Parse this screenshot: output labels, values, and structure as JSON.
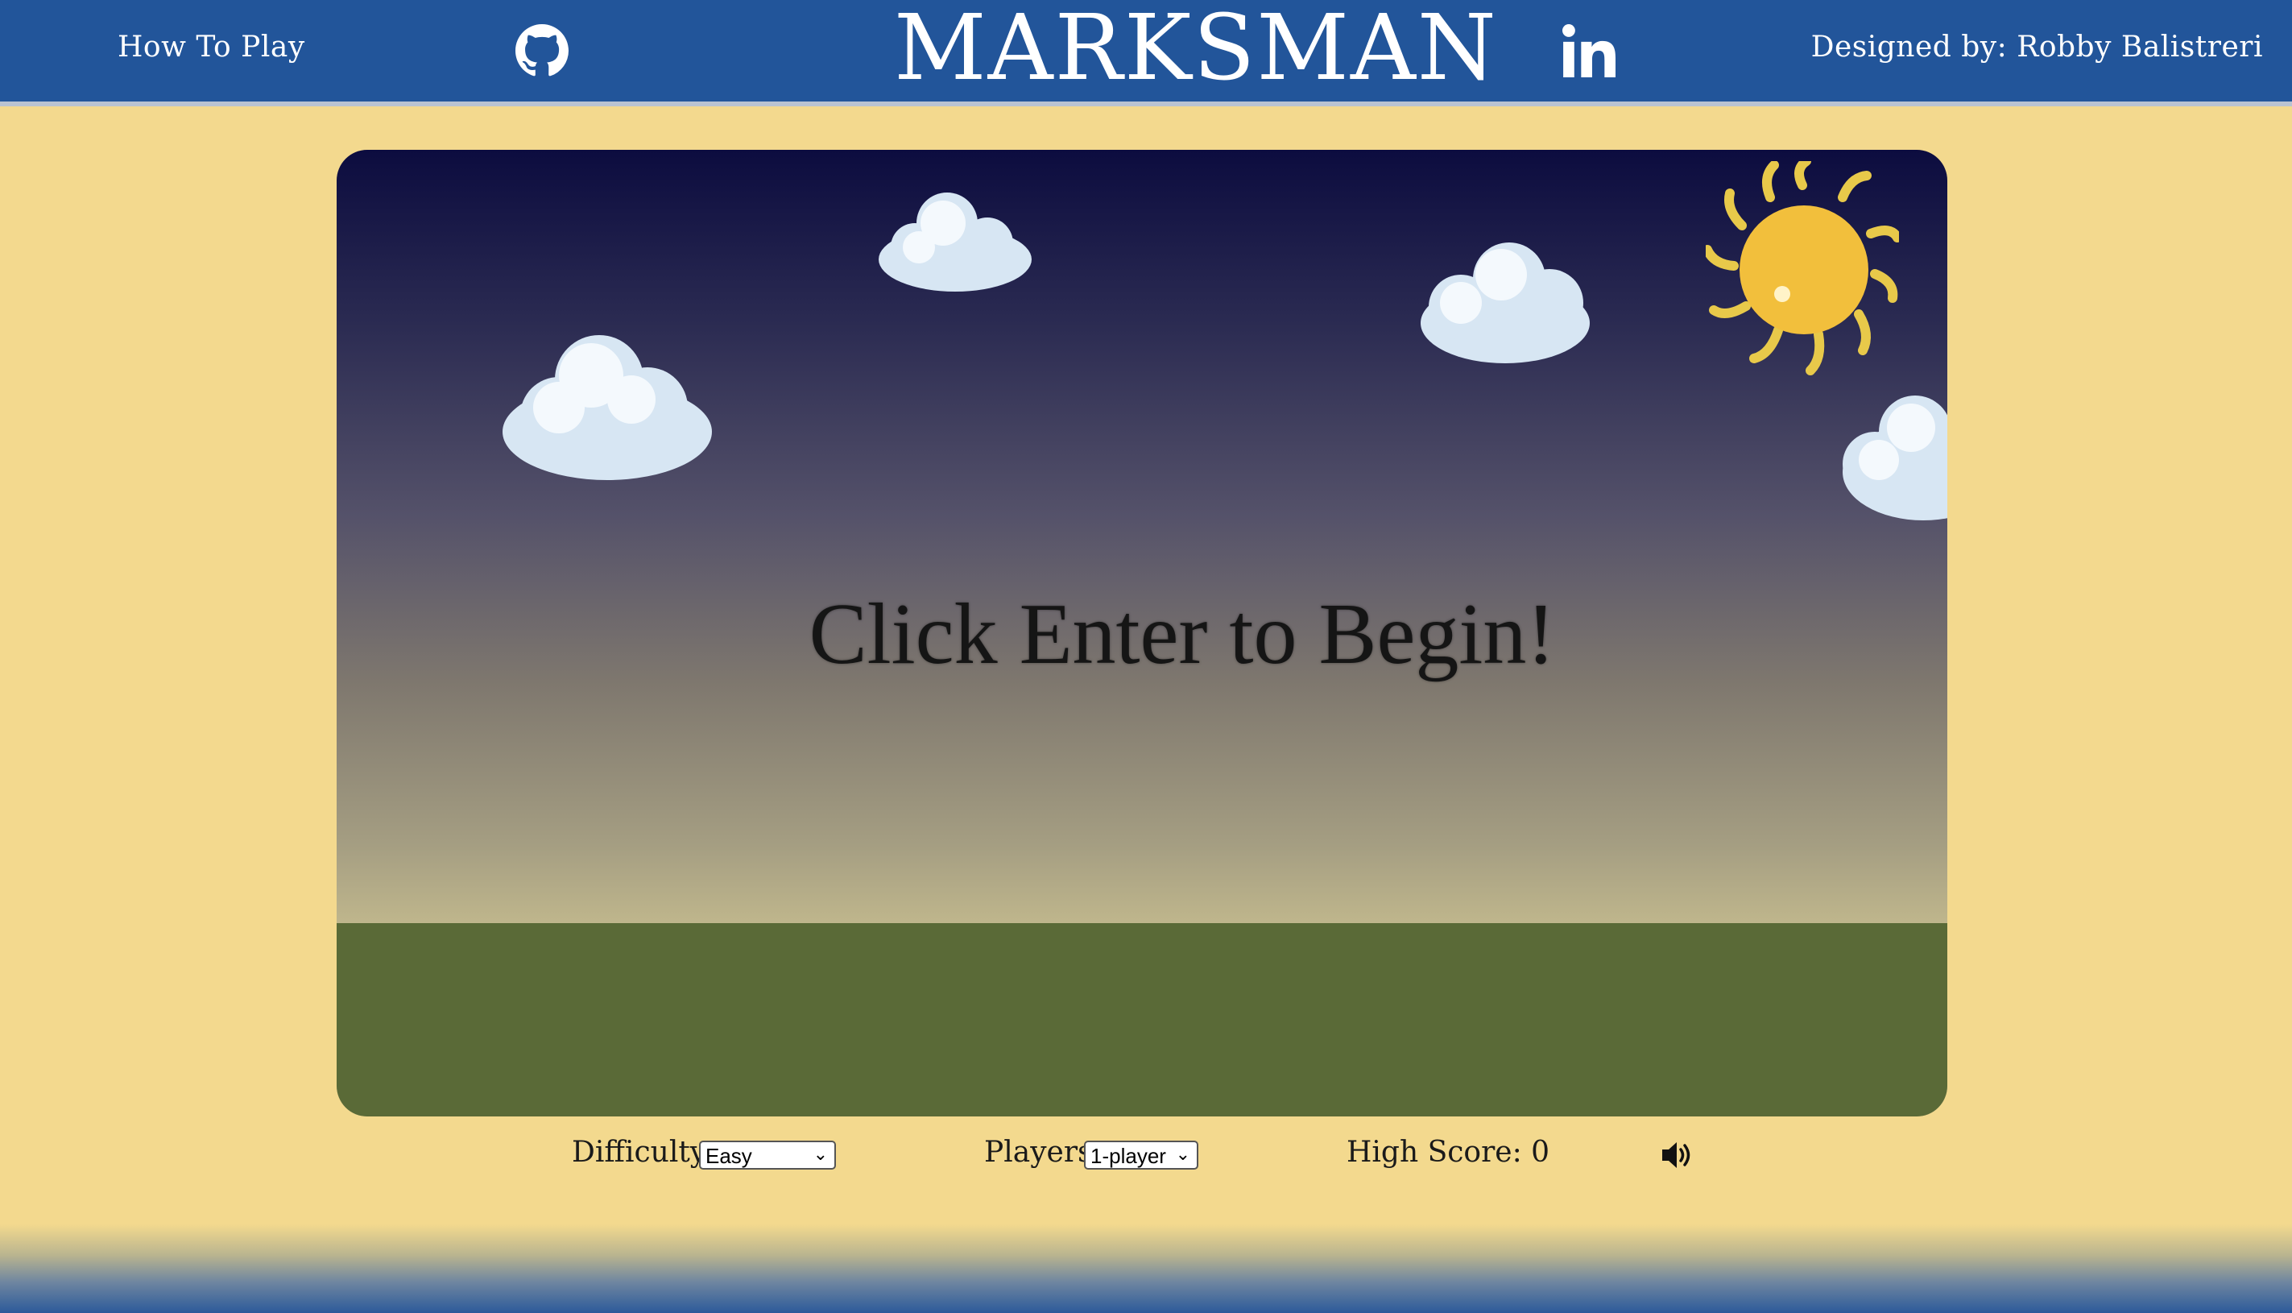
{
  "header": {
    "how_to_play": "How To Play",
    "title": "MARKSMAN",
    "designed_by": "Designed by: Robby Balistreri",
    "icons": [
      "github-icon",
      "linkedin-icon"
    ]
  },
  "game": {
    "prompt": "Click Enter to Begin!"
  },
  "controls": {
    "difficulty_label": "Difficulty",
    "difficulty_value": "Easy",
    "players_label": "Players",
    "players_value": "1-player",
    "high_score": "High Score: 0",
    "sound_icon": "speaker-icon"
  },
  "colors": {
    "header_bg": "#22559a",
    "page_bg": "#f3d98e",
    "ground": "#5a6a37",
    "sky_top": "#0c0c3f",
    "sun": "#f2bf3c"
  }
}
